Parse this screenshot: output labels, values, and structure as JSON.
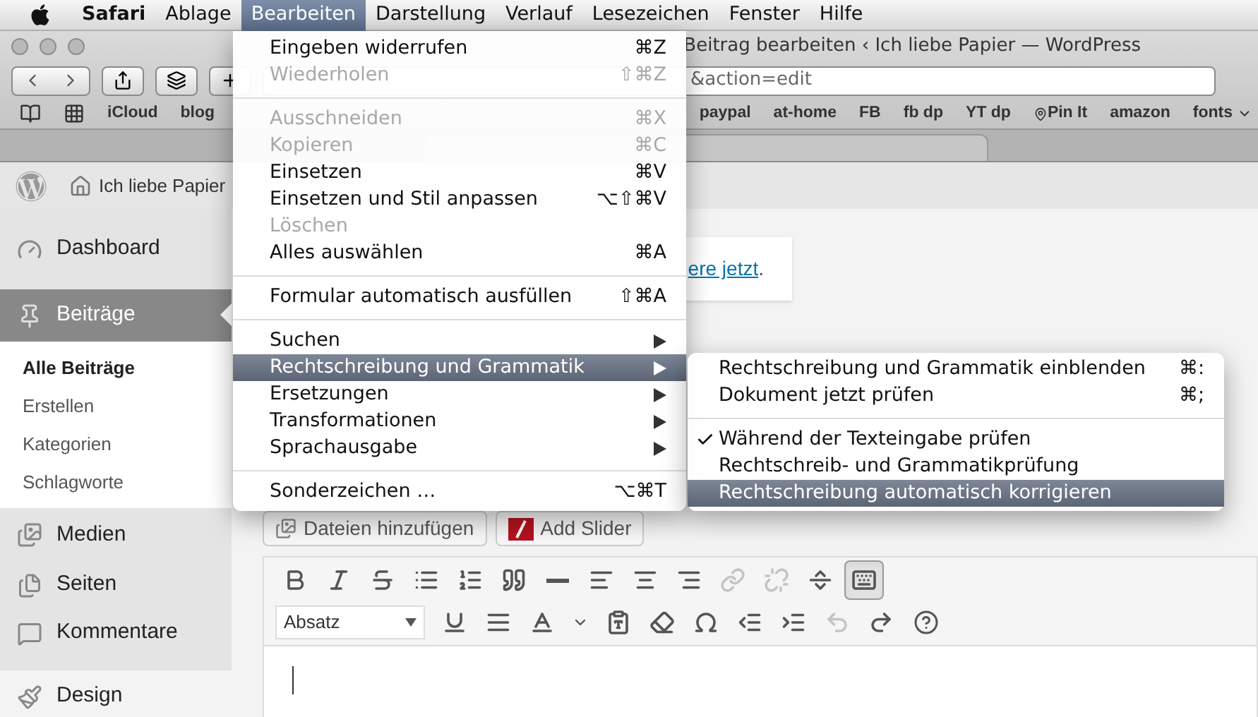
{
  "menu_bar": {
    "items": [
      {
        "label": "Safari",
        "kind": "app",
        "selected": false
      },
      {
        "label": "Ablage",
        "kind": "menu",
        "selected": false
      },
      {
        "label": "Bearbeiten",
        "kind": "menu",
        "selected": true
      },
      {
        "label": "Darstellung",
        "kind": "menu",
        "selected": false
      },
      {
        "label": "Verlauf",
        "kind": "menu",
        "selected": false
      },
      {
        "label": "Lesezeichen",
        "kind": "menu",
        "selected": false
      },
      {
        "label": "Fenster",
        "kind": "menu",
        "selected": false
      },
      {
        "label": "Hilfe",
        "kind": "menu",
        "selected": false
      }
    ]
  },
  "window": {
    "title": "Beitrag bearbeiten ‹ Ich liebe Papier — WordPress",
    "address": "&action=edit",
    "bookmarks_left": [
      "iCloud",
      "blog"
    ],
    "bookmarks": [
      {
        "label": "paypal",
        "kind": "link"
      },
      {
        "label": "at-home",
        "kind": "link"
      },
      {
        "label": "FB",
        "kind": "link"
      },
      {
        "label": "fb dp",
        "kind": "link"
      },
      {
        "label": "YT dp",
        "kind": "link"
      },
      {
        "label": "Pin It",
        "kind": "pin"
      },
      {
        "label": "amazon",
        "kind": "link"
      },
      {
        "label": "fonts",
        "kind": "folder"
      }
    ]
  },
  "edit_menu": {
    "items": [
      {
        "kind": "item",
        "label": "Eingeben widerrufen",
        "shortcut": "⌘Z",
        "disabled": false,
        "selected": false,
        "submenu": false
      },
      {
        "kind": "item",
        "label": "Wiederholen",
        "shortcut": "⇧⌘Z",
        "disabled": true,
        "selected": false,
        "submenu": false
      },
      {
        "kind": "separator"
      },
      {
        "kind": "item",
        "label": "Ausschneiden",
        "shortcut": "⌘X",
        "disabled": true,
        "selected": false,
        "submenu": false
      },
      {
        "kind": "item",
        "label": "Kopieren",
        "shortcut": "⌘C",
        "disabled": true,
        "selected": false,
        "submenu": false
      },
      {
        "kind": "item",
        "label": "Einsetzen",
        "shortcut": "⌘V",
        "disabled": false,
        "selected": false,
        "submenu": false
      },
      {
        "kind": "item",
        "label": "Einsetzen und Stil anpassen",
        "shortcut": "⌥⇧⌘V",
        "disabled": false,
        "selected": false,
        "submenu": false
      },
      {
        "kind": "item",
        "label": "Löschen",
        "disabled": true,
        "selected": false,
        "submenu": false
      },
      {
        "kind": "item",
        "label": "Alles auswählen",
        "shortcut": "⌘A",
        "disabled": false,
        "selected": false,
        "submenu": false
      },
      {
        "kind": "separator"
      },
      {
        "kind": "item",
        "label": "Formular automatisch ausfüllen",
        "shortcut": "⇧⌘A",
        "disabled": false,
        "selected": false,
        "submenu": false
      },
      {
        "kind": "separator"
      },
      {
        "kind": "item",
        "label": "Suchen",
        "disabled": false,
        "selected": false,
        "submenu": true
      },
      {
        "kind": "item",
        "label": "Rechtschreibung und Grammatik",
        "disabled": false,
        "selected": true,
        "submenu": true
      },
      {
        "kind": "item",
        "label": "Ersetzungen",
        "disabled": false,
        "selected": false,
        "submenu": true
      },
      {
        "kind": "item",
        "label": "Transformationen",
        "disabled": false,
        "selected": false,
        "submenu": true
      },
      {
        "kind": "item",
        "label": "Sprachausgabe",
        "disabled": false,
        "selected": false,
        "submenu": true
      },
      {
        "kind": "separator"
      },
      {
        "kind": "item",
        "label": "Sonderzeichen …",
        "shortcut": "⌥⌘T",
        "disabled": false,
        "selected": false,
        "submenu": false
      }
    ]
  },
  "spelling_menu": {
    "items": [
      {
        "kind": "item",
        "label": "Rechtschreibung und Grammatik einblenden",
        "shortcut": "⌘:",
        "checked": false,
        "selected": false
      },
      {
        "kind": "item",
        "label": "Dokument jetzt prüfen",
        "shortcut": "⌘;",
        "checked": false,
        "selected": false
      },
      {
        "kind": "separator"
      },
      {
        "kind": "item",
        "label": "Während der Texteingabe prüfen",
        "checked": true,
        "selected": false
      },
      {
        "kind": "item",
        "label": "Rechtschreib- und Grammatikprüfung",
        "checked": false,
        "selected": false
      },
      {
        "kind": "item",
        "label": "Rechtschreibung automatisch korrigieren",
        "checked": false,
        "selected": true
      }
    ]
  },
  "admin_bar": {
    "site_title": "Ich liebe Papier"
  },
  "sidebar": {
    "items": [
      {
        "label": "Dashboard",
        "kind": "dashboard",
        "selected": false
      },
      {
        "label": "Beiträge",
        "kind": "posts",
        "selected": true,
        "children": [
          {
            "label": "Alle Beiträge",
            "selected": true
          },
          {
            "label": "Erstellen",
            "selected": false
          },
          {
            "label": "Kategorien",
            "selected": false
          },
          {
            "label": "Schlagworte",
            "selected": false
          }
        ]
      },
      {
        "label": "Medien",
        "kind": "media",
        "selected": false
      },
      {
        "label": "Seiten",
        "kind": "pages",
        "selected": false
      },
      {
        "label": "Kommentare",
        "kind": "comments",
        "selected": false
      },
      {
        "label": "Design",
        "kind": "design",
        "selected": false
      }
    ]
  },
  "notice": {
    "link": "ere jetzt",
    "text": "."
  },
  "buttons": [
    {
      "label": "Dateien hinzufügen",
      "kind": "media"
    },
    {
      "label": "Add Slider",
      "kind": "slider"
    }
  ],
  "editor": {
    "format": "Absatz",
    "toolbar_row_1": [
      {
        "disabled": false,
        "pressed": false
      },
      {
        "disabled": false,
        "pressed": false
      },
      {
        "disabled": false,
        "pressed": false
      },
      {
        "disabled": false,
        "pressed": false
      },
      {
        "disabled": false,
        "pressed": false
      },
      {
        "disabled": false,
        "pressed": false
      },
      {
        "disabled": false,
        "pressed": false
      },
      {
        "disabled": false,
        "pressed": false
      },
      {
        "disabled": false,
        "pressed": false
      },
      {
        "disabled": false,
        "pressed": false
      },
      {
        "disabled": true,
        "pressed": false
      },
      {
        "disabled": true,
        "pressed": false
      },
      {
        "disabled": false,
        "pressed": false
      },
      {
        "disabled": false,
        "pressed": true
      }
    ],
    "toolbar_row_2": [
      {
        "disabled": false,
        "pressed": false
      },
      {
        "disabled": false,
        "pressed": false
      },
      {
        "disabled": false,
        "pressed": false
      },
      {
        "disabled": false,
        "pressed": false
      },
      {
        "disabled": false,
        "pressed": false
      },
      {
        "disabled": false,
        "pressed": false
      },
      {
        "disabled": false,
        "pressed": false
      },
      {
        "disabled": false,
        "pressed": false
      },
      {
        "disabled": false,
        "pressed": false
      },
      {
        "disabled": true,
        "pressed": false
      },
      {
        "disabled": false,
        "pressed": false
      }
    ]
  }
}
